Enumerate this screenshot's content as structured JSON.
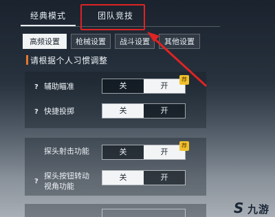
{
  "top_tabs": {
    "classic": "经典模式",
    "team": "团队竞技"
  },
  "sub_tabs": [
    "高频设置",
    "枪械设置",
    "战斗设置",
    "其他设置"
  ],
  "section_title": "请根据个人习惯调整",
  "settings": [
    {
      "q": "?",
      "label": "辅助瞄准",
      "off": "关",
      "on": "开",
      "badge": "荐",
      "state": "on"
    },
    {
      "q": "?",
      "label": "快捷投掷",
      "off": "关",
      "on": "开",
      "state": "off"
    },
    {
      "label": "探头射击功能",
      "off": "关",
      "on": "开",
      "badge": "荐",
      "state": "on"
    },
    {
      "q": "?",
      "label_line1": "探头按钮转动",
      "label_line2": "视角功能",
      "off": "关",
      "on": "开",
      "state": "off"
    }
  ],
  "colors": {
    "highlight": "#e02323",
    "accent": "#e8792a",
    "badge": "#f1c12c"
  },
  "icons": {
    "annotation": "red-arrow-icon",
    "logo": "jiuyou-logo-icon"
  }
}
